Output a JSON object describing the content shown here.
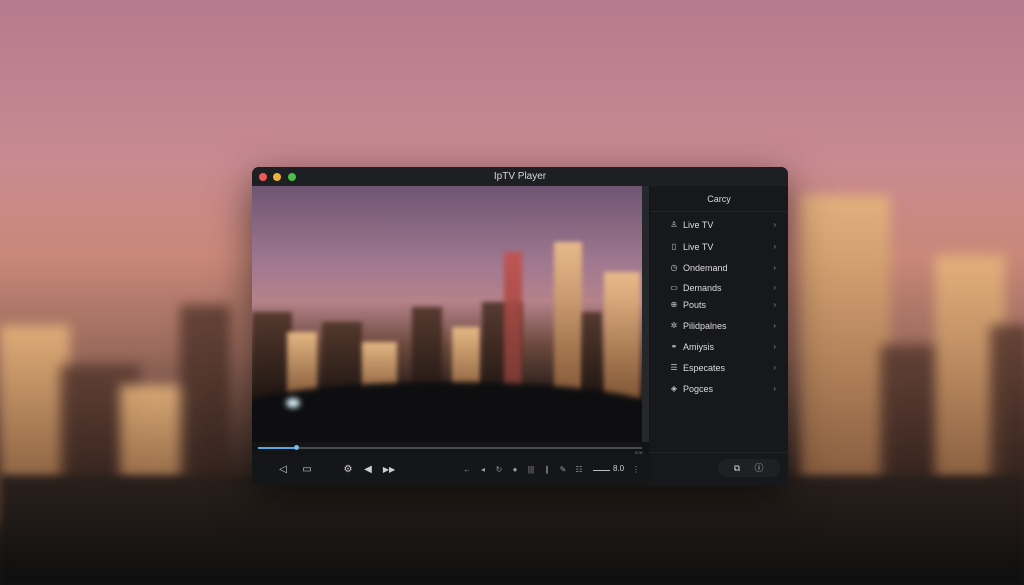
{
  "window": {
    "title": "IpTV Player"
  },
  "player": {
    "progress_fraction": 0.1,
    "time_start": "",
    "time_end": "0:00",
    "volume_value": "8.0",
    "controls": [
      {
        "name": "prev-icon",
        "glyph": "◁"
      },
      {
        "name": "screen-icon",
        "glyph": "▭"
      },
      {
        "name": "settings-icon",
        "glyph": "⚙"
      },
      {
        "name": "volume-icon",
        "glyph": "◀"
      },
      {
        "name": "play-icon",
        "glyph": "▶▶"
      }
    ]
  },
  "sidebar": {
    "title": "Carcy",
    "items": [
      {
        "icon": "user-icon",
        "glyph": "♙",
        "label": "Live TV"
      },
      {
        "icon": "tv-icon",
        "glyph": "▯",
        "label": "Live TV"
      },
      {
        "icon": "clock-icon",
        "glyph": "◷",
        "label": "Ondemand"
      },
      {
        "icon": "screen-icon",
        "glyph": "▭",
        "label": "Demands"
      },
      {
        "icon": "plus-icon",
        "glyph": "⊕",
        "label": "Pouts"
      },
      {
        "icon": "gear-icon",
        "glyph": "✲",
        "label": "Pilidpalnes"
      },
      {
        "icon": "link-icon",
        "glyph": "⚭",
        "label": "Amiysis"
      },
      {
        "icon": "list-icon",
        "glyph": "☰",
        "label": "Especates"
      },
      {
        "icon": "diamond-icon",
        "glyph": "◈",
        "label": "Pogces"
      }
    ]
  }
}
